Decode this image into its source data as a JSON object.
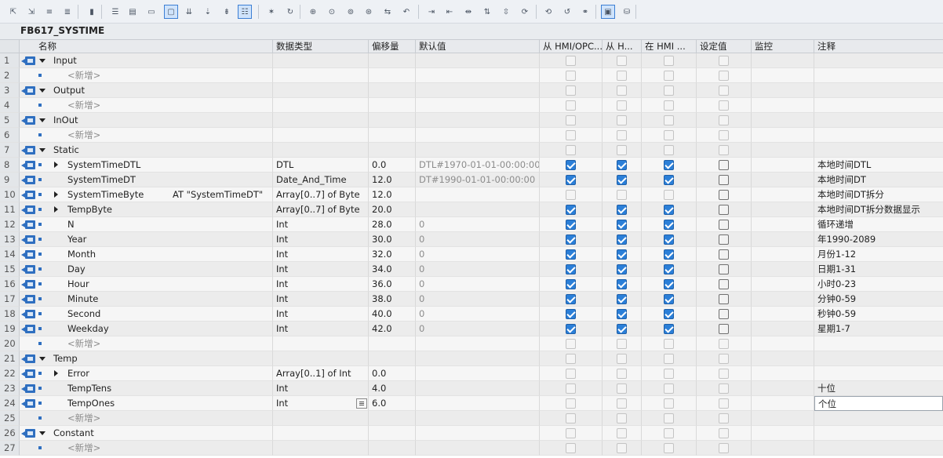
{
  "block_title": "FB617_SYSTIME",
  "columns": {
    "name": "名称",
    "datatype": "数据类型",
    "offset": "偏移量",
    "default": "默认值",
    "hmi_opc": "从 HMI/OPC...",
    "from_h": "从 H...",
    "in_hmi": "在 HMI ...",
    "setpoint": "设定值",
    "monitor": "监控",
    "comment": "注释"
  },
  "toolbar_icons": [
    "insert-row-icon",
    "delete-row-icon",
    "add-row-icon",
    "append-row-icon",
    "browse-icon",
    "align-left-icon",
    "align-table-icon",
    "properties-icon",
    "comment-icon",
    "load-icon",
    "load-start-icon",
    "load-all-icon",
    "list-icon",
    "star-icon",
    "refresh-icon",
    "copy-icon",
    "snapshot-icon",
    "snapshot-load-icon",
    "snapshot-save-icon",
    "transfer-icon",
    "arrow-back-icon",
    "indent-icon",
    "outdent-icon",
    "align-icon",
    "sort-icon",
    "expand-icon",
    "sync-icon",
    "update-icon",
    "undo-icon",
    "monitor-icon",
    "display-icon",
    "database-icon"
  ],
  "rows": [
    {
      "num": "1",
      "kind": "section",
      "io": true,
      "name": "Input",
      "expand": "down"
    },
    {
      "num": "2",
      "kind": "new",
      "name": "<新增>"
    },
    {
      "num": "3",
      "kind": "section",
      "io": true,
      "name": "Output",
      "expand": "down"
    },
    {
      "num": "4",
      "kind": "new",
      "name": "<新增>"
    },
    {
      "num": "5",
      "kind": "section",
      "io": true,
      "name": "InOut",
      "expand": "down"
    },
    {
      "num": "6",
      "kind": "new",
      "name": "<新增>"
    },
    {
      "num": "7",
      "kind": "section",
      "io": true,
      "name": "Static",
      "expand": "down"
    },
    {
      "num": "8",
      "kind": "var",
      "io": true,
      "expand": "right",
      "name": "SystemTimeDTL",
      "type": "DTL",
      "offset": "0.0",
      "default": "DTL#1970-01-01-00:00:00",
      "hmi": true,
      "fh": true,
      "ih": true,
      "set": true,
      "comment": "本地时间DTL"
    },
    {
      "num": "9",
      "kind": "var",
      "io": true,
      "name": "SystemTimeDT",
      "type": "Date_And_Time",
      "offset": "12.0",
      "default": "DT#1990-01-01-00:00:00",
      "hmi": true,
      "fh": true,
      "ih": true,
      "set": true,
      "comment": "本地时间DT"
    },
    {
      "num": "10",
      "kind": "var",
      "io": true,
      "expand": "right",
      "name": "SystemTimeByte",
      "at": "AT \"SystemTimeDT\"",
      "type": "Array[0..7] of Byte",
      "offset": "12.0",
      "default": "",
      "hmi": false,
      "fh": false,
      "ih": false,
      "set": true,
      "comment": "本地时间DT拆分"
    },
    {
      "num": "11",
      "kind": "var",
      "io": true,
      "expand": "right",
      "name": "TempByte",
      "type": "Array[0..7] of Byte",
      "offset": "20.0",
      "default": "",
      "hmi": true,
      "fh": true,
      "ih": true,
      "set": true,
      "comment": "本地时间DT拆分数据显示"
    },
    {
      "num": "12",
      "kind": "var",
      "io": true,
      "name": "N",
      "type": "Int",
      "offset": "28.0",
      "default": "0",
      "hmi": true,
      "fh": true,
      "ih": true,
      "set": true,
      "comment": "循环递增"
    },
    {
      "num": "13",
      "kind": "var",
      "io": true,
      "name": "Year",
      "type": "Int",
      "offset": "30.0",
      "default": "0",
      "hmi": true,
      "fh": true,
      "ih": true,
      "set": true,
      "comment": "年1990-2089"
    },
    {
      "num": "14",
      "kind": "var",
      "io": true,
      "name": "Month",
      "type": "Int",
      "offset": "32.0",
      "default": "0",
      "hmi": true,
      "fh": true,
      "ih": true,
      "set": true,
      "comment": "月份1-12"
    },
    {
      "num": "15",
      "kind": "var",
      "io": true,
      "name": "Day",
      "type": "Int",
      "offset": "34.0",
      "default": "0",
      "hmi": true,
      "fh": true,
      "ih": true,
      "set": true,
      "comment": "日期1-31"
    },
    {
      "num": "16",
      "kind": "var",
      "io": true,
      "name": "Hour",
      "type": "Int",
      "offset": "36.0",
      "default": "0",
      "hmi": true,
      "fh": true,
      "ih": true,
      "set": true,
      "comment": "小时0-23"
    },
    {
      "num": "17",
      "kind": "var",
      "io": true,
      "name": "Minute",
      "type": "Int",
      "offset": "38.0",
      "default": "0",
      "hmi": true,
      "fh": true,
      "ih": true,
      "set": true,
      "comment": "分钟0-59"
    },
    {
      "num": "18",
      "kind": "var",
      "io": true,
      "name": "Second",
      "type": "Int",
      "offset": "40.0",
      "default": "0",
      "hmi": true,
      "fh": true,
      "ih": true,
      "set": true,
      "comment": "秒钟0-59"
    },
    {
      "num": "19",
      "kind": "var",
      "io": true,
      "name": "Weekday",
      "type": "Int",
      "offset": "42.0",
      "default": "0",
      "hmi": true,
      "fh": true,
      "ih": true,
      "set": true,
      "comment": "星期1-7"
    },
    {
      "num": "20",
      "kind": "new",
      "name": "<新增>"
    },
    {
      "num": "21",
      "kind": "section",
      "io": true,
      "name": "Temp",
      "expand": "down"
    },
    {
      "num": "22",
      "kind": "var",
      "io": true,
      "expand": "right",
      "name": "Error",
      "type": "Array[0..1] of Int",
      "offset": "0.0",
      "default": "",
      "cbs": false
    },
    {
      "num": "23",
      "kind": "var",
      "io": true,
      "name": "TempTens",
      "type": "Int",
      "offset": "4.0",
      "default": "",
      "cbs": false,
      "comment": "十位"
    },
    {
      "num": "24",
      "kind": "var",
      "io": true,
      "name": "TempOnes",
      "type": "Int",
      "offset": "6.0",
      "default": "",
      "cbs": false,
      "comment": "个位",
      "editing": true
    },
    {
      "num": "25",
      "kind": "new",
      "name": "<新增>"
    },
    {
      "num": "26",
      "kind": "section",
      "io": true,
      "name": "Constant",
      "expand": "down"
    },
    {
      "num": "27",
      "kind": "new",
      "name": "<新增>"
    }
  ],
  "colors": {
    "accent": "#2f6fc0",
    "checked": "#2b7fd8"
  }
}
